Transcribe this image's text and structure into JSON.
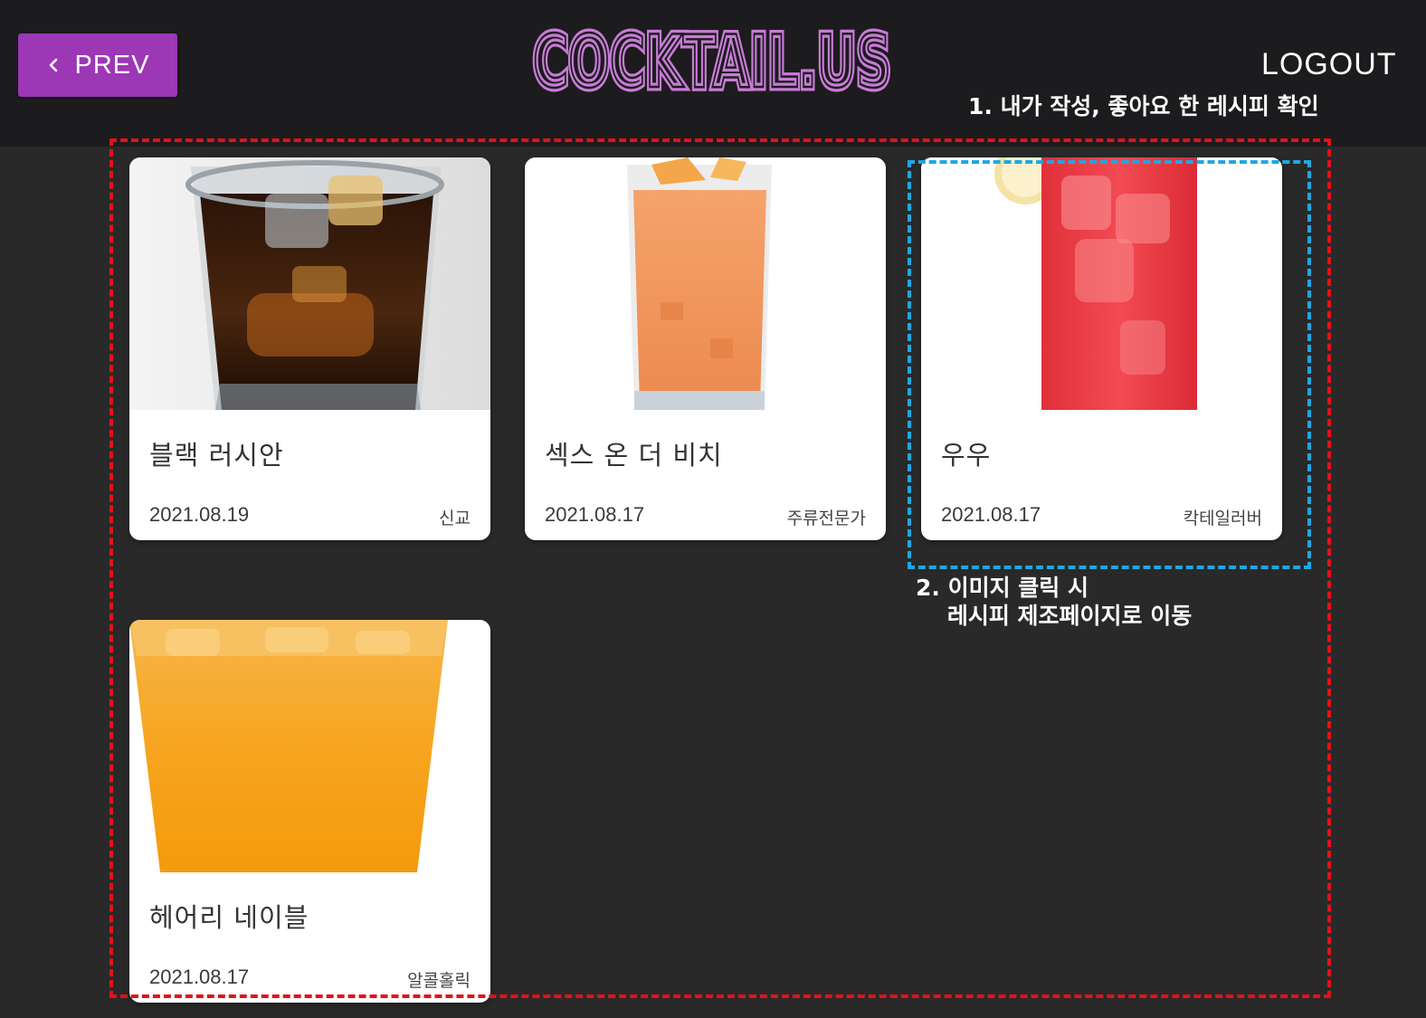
{
  "header": {
    "prev_label": "PREV",
    "logo_text": "COCKTAIL.US",
    "logout_label": "LOGOUT",
    "accent_color": "#9c37b5"
  },
  "annotations": {
    "note_1": "1. 내가 작성, 좋아요 한 레시피 확인",
    "note_2": "2. 이미지 클릭 시\n    레시피 제조페이지로 이동"
  },
  "recipes": [
    {
      "name": "블랙 러시안",
      "date": "2021.08.19",
      "author": "신교",
      "image": "dark-cocktail-glass"
    },
    {
      "name": "섹스 온 더 비치",
      "date": "2021.08.17",
      "author": "주류전문가",
      "image": "orange-tall-cocktail"
    },
    {
      "name": "우우",
      "date": "2021.08.17",
      "author": "칵테일러버",
      "image": "red-tall-cocktail"
    },
    {
      "name": "헤어리 네이블",
      "date": "2021.08.17",
      "author": "알콜홀릭",
      "image": "orange-cocktail-glass"
    }
  ]
}
